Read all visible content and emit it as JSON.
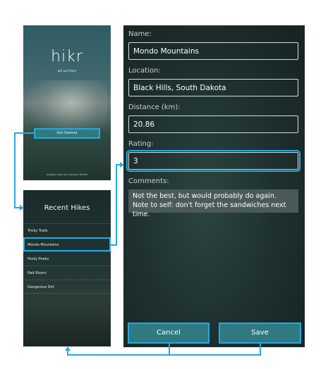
{
  "splash": {
    "title": "hikr",
    "tagline": "get out there",
    "get_started_label": "Get Started",
    "credit": "original video by Graham Uhelski"
  },
  "list": {
    "title": "Recent Hikes",
    "items": [
      {
        "label": "Tricky Trails"
      },
      {
        "label": "Mondo Mountains"
      },
      {
        "label": "Pesky Peaks"
      },
      {
        "label": "Rad Rivers"
      },
      {
        "label": "Dangerous Dirt"
      }
    ],
    "selected": "Mondo Mountains"
  },
  "detail": {
    "name_label": "Name:",
    "name_value": "Mondo Mountains",
    "location_label": "Location:",
    "location_value": "Black Hills, South Dakota",
    "distance_label": "Distance (km):",
    "distance_value": "20.86",
    "rating_label": "Rating:",
    "rating_value": "3",
    "comments_label": "Comments:",
    "comments_value": "Not the best, but would probably do again. Note to self: don't forget the sandwiches next time.",
    "cancel_label": "Cancel",
    "save_label": "Save"
  },
  "colors": {
    "accent": "#27a8e0",
    "button": "#2f7a80"
  }
}
